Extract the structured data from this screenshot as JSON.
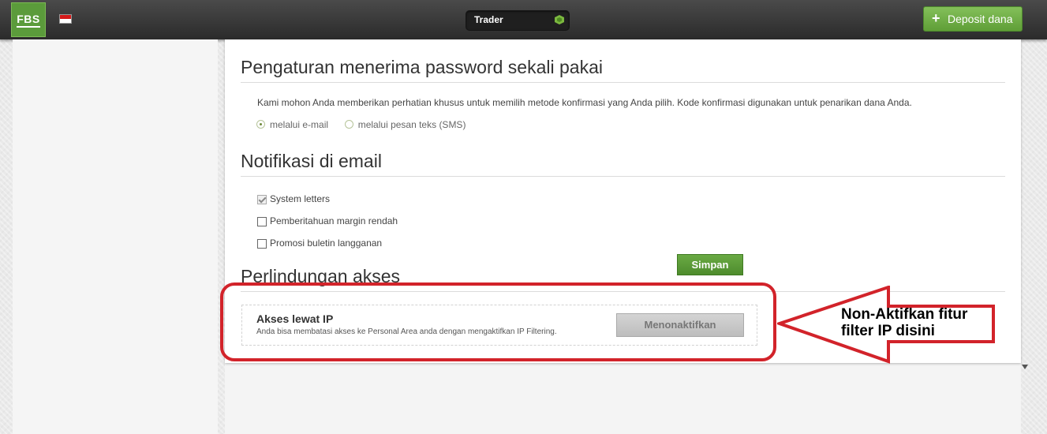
{
  "header": {
    "logo_text": "FBS",
    "flag_icon": "indonesia-flag-icon",
    "account_label": "Trader",
    "account_icon": "green-gem-icon",
    "deposit_label": "Deposit dana",
    "deposit_icon": "plus-icon",
    "colors": {
      "brand_green": "#5b9b3b",
      "topbar": "#333333"
    }
  },
  "otp_section": {
    "title": "Pengaturan menerima password sekali pakai",
    "description": "Kami mohon Anda memberikan perhatian khusus untuk memilih metode konfirmasi yang Anda pilih. Kode konfirmasi digunakan untuk penarikan dana Anda.",
    "options": [
      {
        "label": "melalui e-mail",
        "selected": true
      },
      {
        "label": "melalui pesan teks (SMS)",
        "selected": false
      }
    ]
  },
  "email_section": {
    "title": "Notifikasi di email",
    "checkboxes": [
      {
        "label": "System letters",
        "checked": true
      },
      {
        "label": "Pemberitahuan margin rendah",
        "checked": false
      },
      {
        "label": "Promosi buletin langganan",
        "checked": false
      }
    ],
    "save_label": "Simpan"
  },
  "access_section": {
    "title": "Perlindungan akses",
    "ip_title": "Akses lewat IP",
    "ip_desc": "Anda bisa membatasi akses ke Personal Area anda dengan mengaktifkan IP Filtering.",
    "deactivate_label": "Menonaktifkan"
  },
  "annotation": {
    "line1": "Non-Aktifkan fitur",
    "line2": "filter IP disini",
    "color": "#d2232a"
  }
}
